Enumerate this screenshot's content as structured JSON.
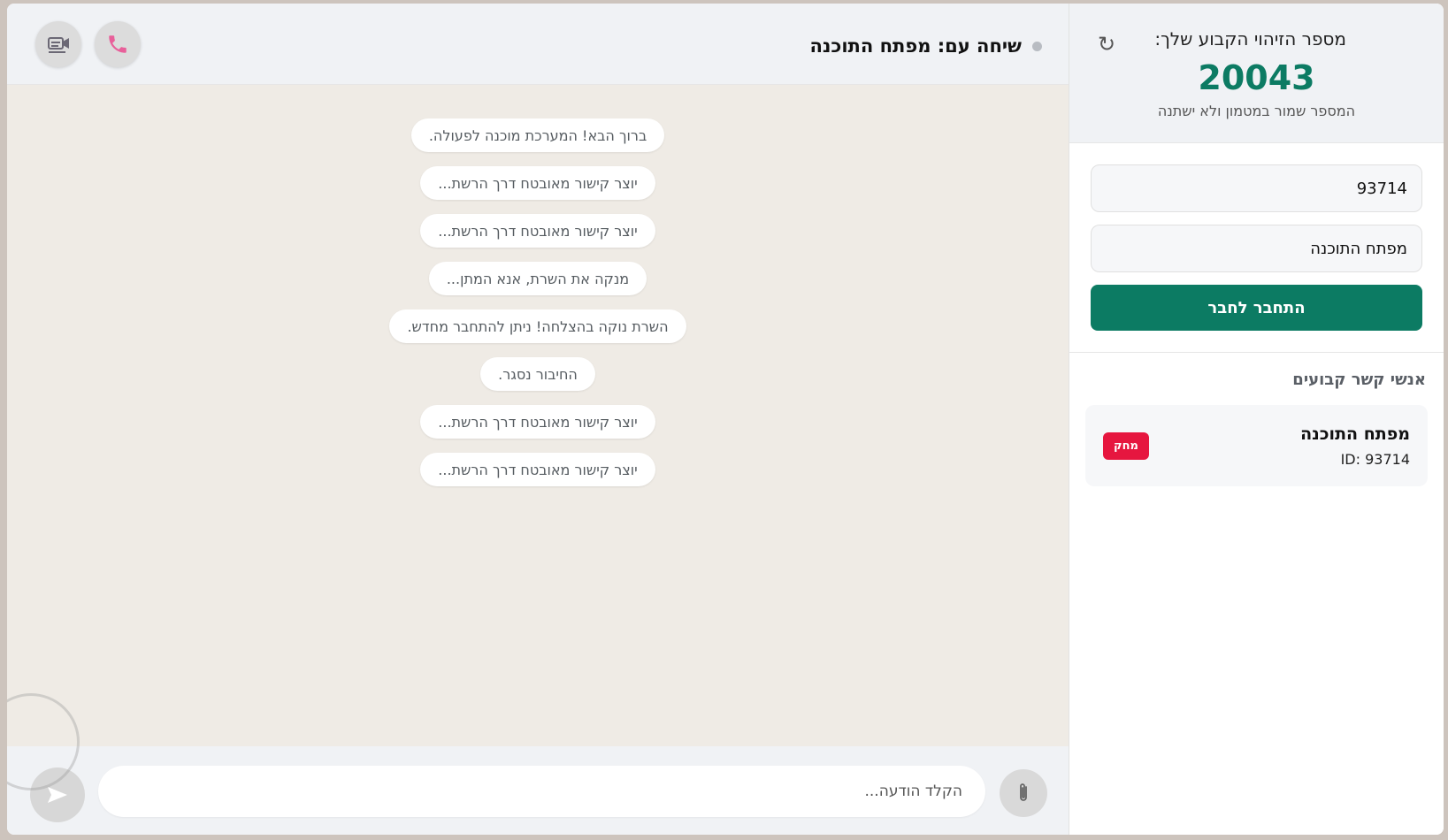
{
  "chat": {
    "title": "שיחה עם: מפתח התוכנה",
    "messages": [
      "ברוך הבא! המערכת מוכנה לפעולה.",
      "יוצר קישור מאובטח דרך הרשת...",
      "יוצר קישור מאובטח דרך הרשת...",
      "מנקה את השרת, אנא המתן...",
      "השרת נוקה בהצלחה! ניתן להתחבר מחדש.",
      "החיבור נסגר.",
      "יוצר קישור מאובטח דרך הרשת...",
      "יוצר קישור מאובטח דרך הרשת..."
    ],
    "input_placeholder": "הקלד הודעה...",
    "icons": {
      "video": "video-icon",
      "call": "phone-icon",
      "send": "send-icon",
      "attach": "paperclip-icon"
    }
  },
  "sidebar": {
    "id_label": "מספר הזיהוי הקבוע שלך:",
    "id_number": "20043",
    "id_note": "המספר שמור במטמון ולא ישתנה",
    "refresh_icon": "↻",
    "form": {
      "id_value": "93714",
      "name_value": "מפתח התוכנה",
      "connect_label": "התחבר לחבר"
    },
    "contacts_title": "אנשי קשר קבועים",
    "contacts": [
      {
        "name": "מפתח התוכנה",
        "id": "ID: 93714",
        "delete_label": "מחק"
      }
    ]
  },
  "colors": {
    "accent": "#0c7b63",
    "danger": "#e6163f",
    "chat_bg": "#efebe5",
    "call_icon": "#e8609a"
  }
}
